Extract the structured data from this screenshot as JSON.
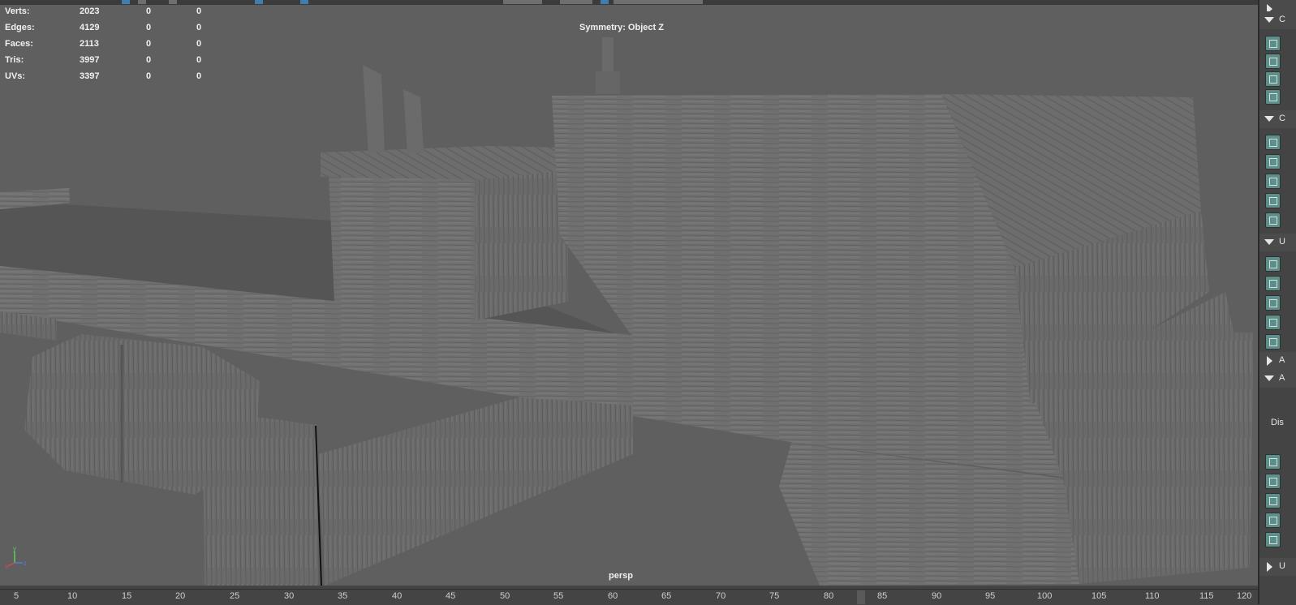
{
  "hud": {
    "rows": [
      {
        "label": "Verts:",
        "total": "2023",
        "selected": "0",
        "component": "0"
      },
      {
        "label": "Edges:",
        "total": "4129",
        "selected": "0",
        "component": "0"
      },
      {
        "label": "Faces:",
        "total": "2113",
        "selected": "0",
        "component": "0"
      },
      {
        "label": "Tris:",
        "total": "3997",
        "selected": "0",
        "component": "0"
      },
      {
        "label": "UVs:",
        "total": "3397",
        "selected": "0",
        "component": "0"
      }
    ],
    "symmetry": "Symmetry: Object Z",
    "camera": "persp"
  },
  "axis": {
    "y": "y",
    "z": "z",
    "x": "x"
  },
  "timeline": {
    "ticks": [
      "5",
      "10",
      "15",
      "20",
      "25",
      "30",
      "35",
      "40",
      "45",
      "50",
      "55",
      "60",
      "65",
      "70",
      "75",
      "80",
      "85",
      "90",
      "95",
      "100",
      "105",
      "110",
      "115",
      "120"
    ],
    "current_frame": 83
  },
  "sidebar": {
    "sections": [
      {
        "letter": "",
        "icon": "triangle-down"
      },
      {
        "letter": "C",
        "icon": "triangle-down"
      },
      {
        "letter": "C",
        "icon": "triangle-down"
      },
      {
        "letter": "U",
        "icon": "triangle-down"
      },
      {
        "letter": "A",
        "icon": "triangle-right"
      },
      {
        "letter": "A",
        "icon": "triangle-down"
      },
      {
        "letter": "U",
        "icon": "triangle-right"
      }
    ],
    "truncated_label": "Dis"
  },
  "colors": {
    "viewport_bg": "#5f5f5f",
    "wood": "#707070",
    "accent": "#3e7fb0",
    "icon_teal": "#5a8f8a"
  }
}
